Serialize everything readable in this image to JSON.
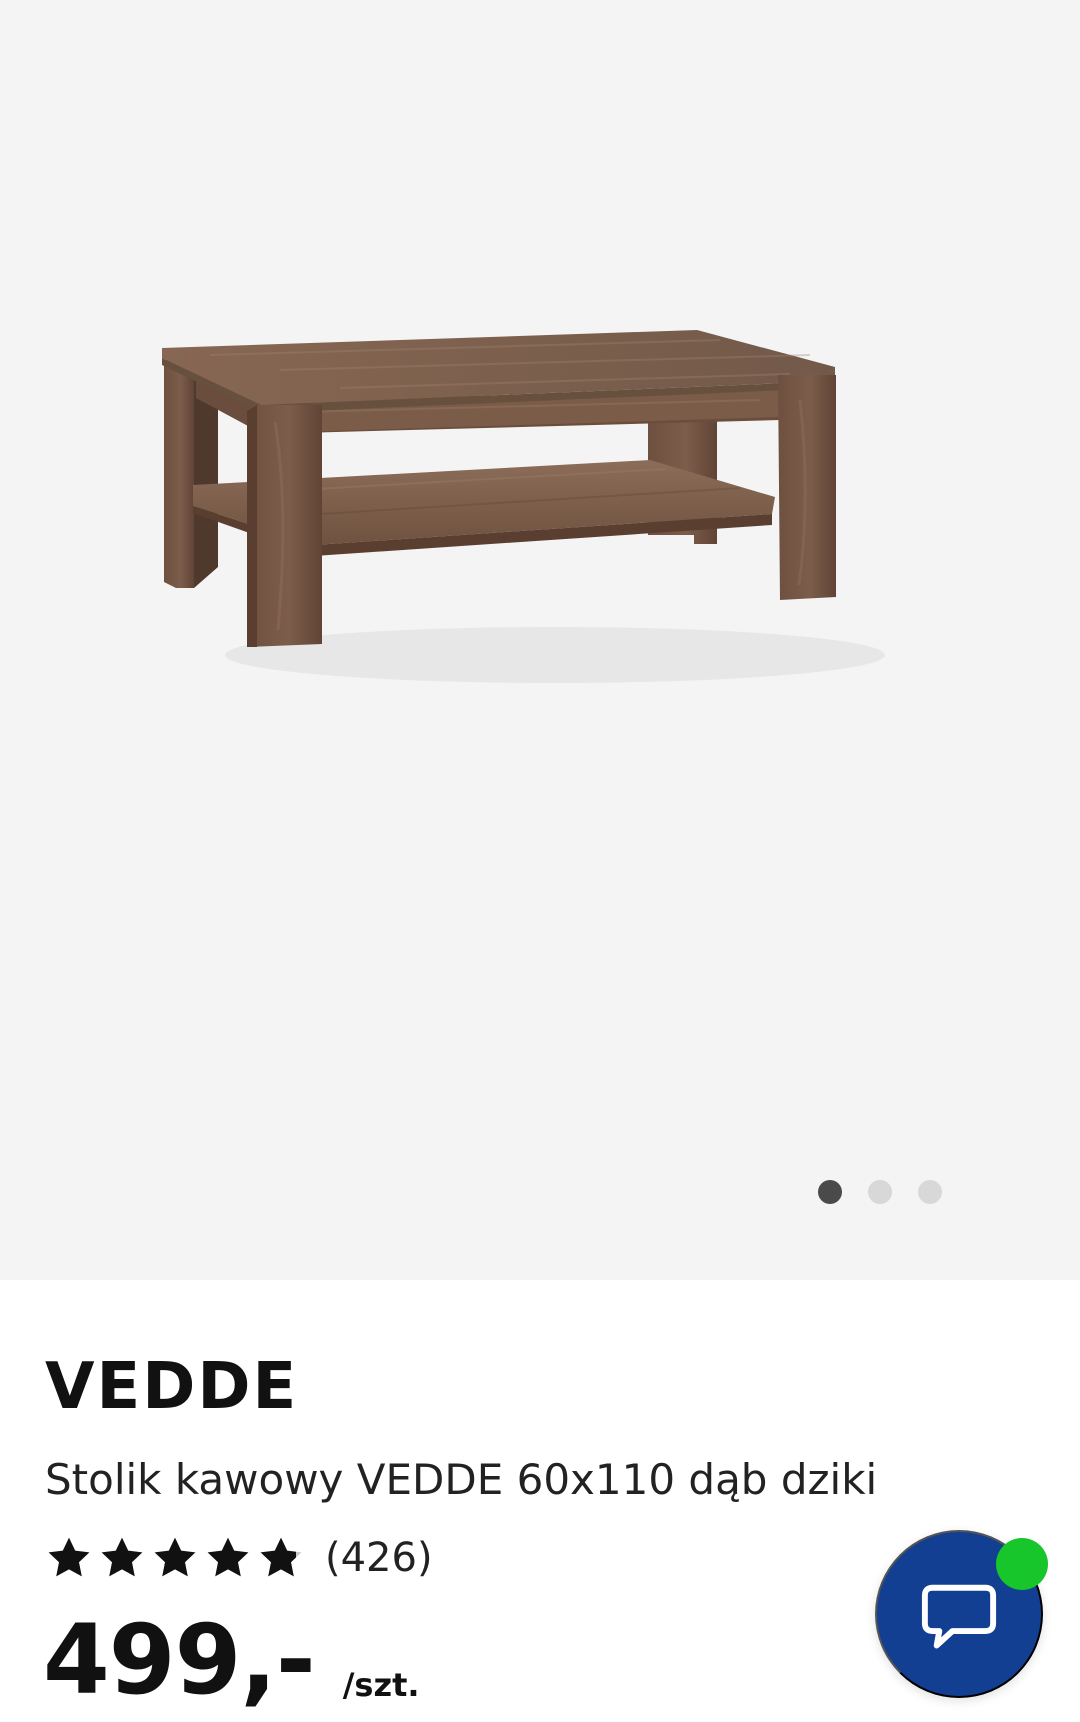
{
  "product": {
    "brand": "VEDDE",
    "description": "Stolik kawowy VEDDE 60x110 dąb dziki",
    "rating": 4.6,
    "review_count": "(426)",
    "price": "499,-",
    "price_unit": "/szt."
  },
  "gallery": {
    "image_icon": "coffee-table-image",
    "total_images": 3,
    "active_image": 1
  },
  "chat": {
    "icon": "chat-bubble-icon",
    "status": "online"
  },
  "colors": {
    "gallery_background": "#f4f4f4",
    "chat_button": "#123f92",
    "online_status": "#16c62b",
    "active_dot": "#4a4a4a",
    "inactive_dot": "#d8d8d8",
    "wood_main": "#7a5a43",
    "wood_dark": "#5e4332"
  }
}
